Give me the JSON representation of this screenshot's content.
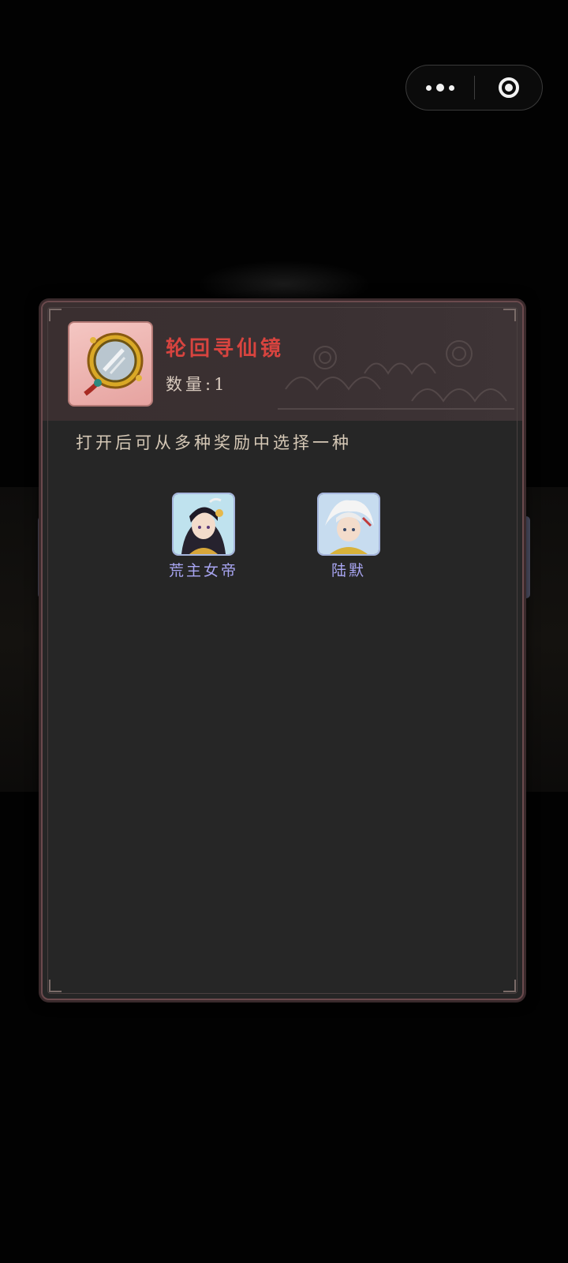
{
  "capsule": {
    "more_icon": "more-dots-icon",
    "close_icon": "target-circle-icon"
  },
  "item": {
    "name": "轮回寻仙镜",
    "quantity_label": "数量:",
    "quantity": "1",
    "icon": "mirror-icon"
  },
  "description": "打开后可从多种奖励中选择一种",
  "rewards": [
    {
      "name": "荒主女帝",
      "icon": "character-portrait-icon"
    },
    {
      "name": "陆默",
      "icon": "character-portrait-icon"
    }
  ],
  "colors": {
    "title": "#d8443f",
    "reward_name": "#a9a6f3",
    "panel_bg": "#262626",
    "header_bg": "#3a2f30"
  }
}
